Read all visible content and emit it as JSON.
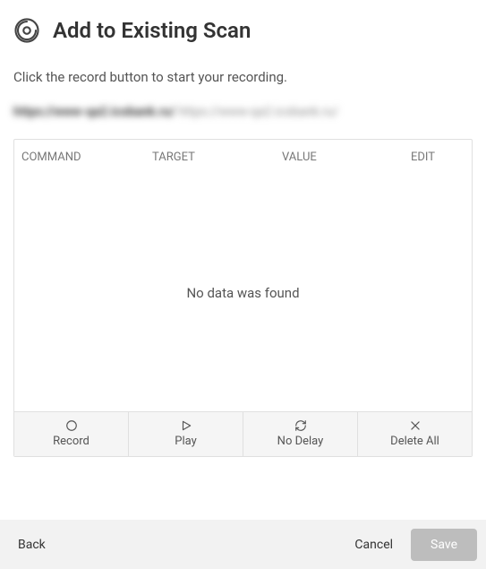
{
  "header": {
    "title": "Add to Existing Scan"
  },
  "instruction": "Click the record button to start your recording.",
  "url": {
    "bold": "https://www-qa2.icobank.ru/",
    "light": "https://www-qa2.icobank.ru/"
  },
  "table": {
    "headers": {
      "command": "COMMAND",
      "target": "TARGET",
      "value": "VALUE",
      "edit": "EDIT"
    },
    "empty_message": "No data was found"
  },
  "toolbar": {
    "record": "Record",
    "play": "Play",
    "no_delay": "No Delay",
    "delete_all": "Delete All"
  },
  "footer": {
    "back": "Back",
    "cancel": "Cancel",
    "save": "Save"
  }
}
